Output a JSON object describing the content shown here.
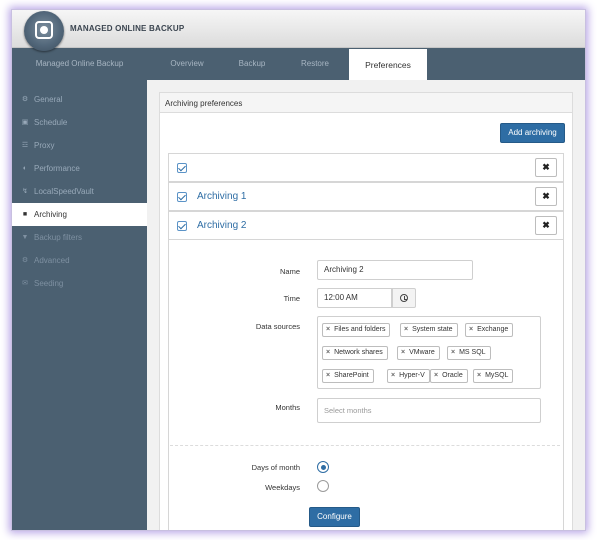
{
  "app": {
    "title": "MANAGED ONLINE BACKUP"
  },
  "topnav": {
    "items": [
      {
        "label": "Managed Online Backup"
      },
      {
        "label": "Overview"
      },
      {
        "label": "Backup"
      },
      {
        "label": "Restore"
      },
      {
        "label": "Preferences",
        "active": true
      }
    ]
  },
  "sidebar": {
    "items": [
      {
        "label": "General",
        "icon": "gear-icon"
      },
      {
        "label": "Schedule",
        "icon": "calendar-icon"
      },
      {
        "label": "Proxy",
        "icon": "sitemap-icon"
      },
      {
        "label": "Performance",
        "icon": "dashboard-icon"
      },
      {
        "label": "LocalSpeedVault",
        "icon": "bolt-icon"
      },
      {
        "label": "Archiving",
        "icon": "folder-icon",
        "active": true
      },
      {
        "label": "Backup filters",
        "icon": "filter-icon"
      },
      {
        "label": "Advanced",
        "icon": "gears-icon"
      },
      {
        "label": "Seeding",
        "icon": "envelope-icon"
      }
    ]
  },
  "panel": {
    "title": "Archiving preferences",
    "add_button": "Add archiving",
    "rows": [
      {
        "name": "",
        "checked": true
      },
      {
        "name": "Archiving 1",
        "checked": true
      },
      {
        "name": "Archiving 2",
        "checked": true
      }
    ],
    "form": {
      "name_label": "Name",
      "name_value": "Archiving 2",
      "time_label": "Time",
      "time_value": "12:00 AM",
      "data_sources_label": "Data sources",
      "data_sources": [
        "Files and folders",
        "System state",
        "Exchange",
        "Network shares",
        "VMware",
        "MS SQL",
        "SharePoint",
        "Hyper-V",
        "Oracle",
        "MySQL"
      ],
      "months_label": "Months",
      "months_placeholder": "Select months",
      "days_of_month_label": "Days of month",
      "weekdays_label": "Weekdays",
      "selected_mode": "Days of month",
      "configure_button": "Configure"
    }
  },
  "colors": {
    "nav_bg": "#4b6071",
    "accent": "#2e6da4",
    "halo": "#b9a6e6"
  }
}
